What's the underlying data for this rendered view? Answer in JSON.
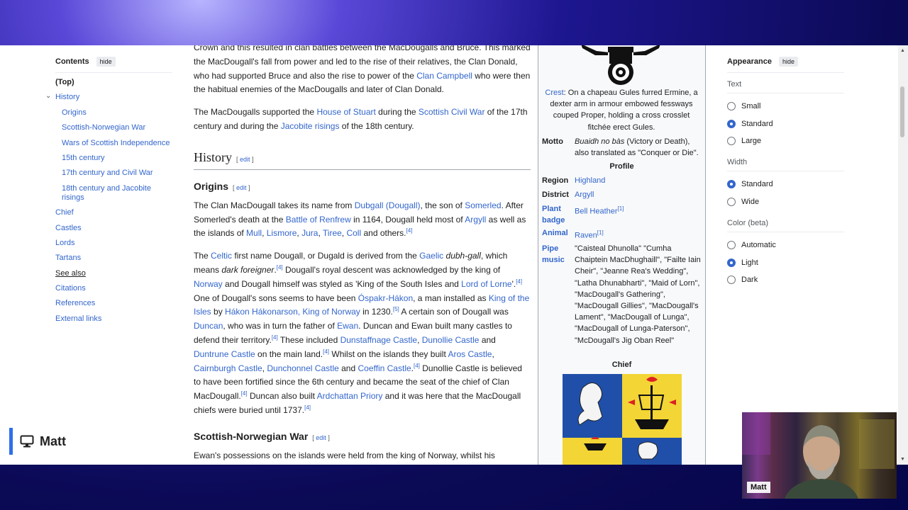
{
  "toc": {
    "title": "Contents",
    "hide_label": "hide",
    "items": [
      {
        "label": "(Top)",
        "level": 0
      },
      {
        "label": "History",
        "level": 0
      },
      {
        "label": "Origins",
        "level": 1
      },
      {
        "label": "Scottish-Norwegian War",
        "level": 1
      },
      {
        "label": "Wars of Scottish Independence",
        "level": 1
      },
      {
        "label": "15th century",
        "level": 1
      },
      {
        "label": "17th century and Civil War",
        "level": 1
      },
      {
        "label": "18th century and Jacobite risings",
        "level": 1
      },
      {
        "label": "Chief",
        "level": 0
      },
      {
        "label": "Castles",
        "level": 0
      },
      {
        "label": "Lords",
        "level": 0
      },
      {
        "label": "Tartans",
        "level": 0
      },
      {
        "label": "See also",
        "level": 0
      },
      {
        "label": "Citations",
        "level": 0
      },
      {
        "label": "References",
        "level": 0
      },
      {
        "label": "External links",
        "level": 0
      }
    ]
  },
  "article": {
    "p1_a": "Crown and this resulted in clan battles between the MacDougalls and Bruce. This marked the MacDougall's fall from power and led to the rise of their relatives, the Clan Donald, who had supported Bruce and also the rise to power of the ",
    "p1_link": "Clan Campbell",
    "p1_b": " who were then the habitual enemies of the MacDougalls and later of Clan Donald.",
    "p2_a": "The MacDougalls supported the ",
    "p2_l1": "House of Stuart",
    "p2_b": " during the ",
    "p2_l2": "Scottish Civil War",
    "p2_c": " of the 17th century and during the ",
    "p2_l3": "Jacobite risings",
    "p2_d": " of the 18th century.",
    "h_history": "History",
    "edit": "edit",
    "h_origins": "Origins",
    "o1_a": "The Clan MacDougall takes its name from ",
    "o1_l1": "Dubgall (Dougall)",
    "o1_b": ", the son of ",
    "o1_l2": "Somerled",
    "o1_c": ". After Somerled's death at the ",
    "o1_l3": "Battle of Renfrew",
    "o1_d": " in 1164, Dougall held most of ",
    "o1_l4": "Argyll",
    "o1_e": " as well as the islands of ",
    "o1_l5": "Mull",
    "o1_s1": ", ",
    "o1_l6": "Lismore",
    "o1_s2": ", ",
    "o1_l7": "Jura",
    "o1_s3": ", ",
    "o1_l8": "Tiree",
    "o1_s4": ", ",
    "o1_l9": "Coll",
    "o1_f": " and others.",
    "ref4": "[4]",
    "ref5": "[5]",
    "o2_a": "The ",
    "o2_l1": "Celtic",
    "o2_b": " first name Dougall, or Dugald is derived from the ",
    "o2_l2": "Gaelic",
    "o2_c": " ",
    "o2_i1": "dubh-gall",
    "o2_d": ", which means ",
    "o2_i2": "dark foreigner",
    "o2_e": ".",
    "o2_f": " Dougall's royal descent was acknowledged by the king of ",
    "o2_l3": "Norway",
    "o2_g": " and Dougall himself was styled as 'King of the South Isles and ",
    "o2_l4": "Lord of Lorne",
    "o2_h": "'.",
    "o2_i": " One of Dougall's sons seems to have been ",
    "o2_l5": "Óspakr-Hákon",
    "o2_j": ", a man installed as ",
    "o2_l6": "King of the Isles",
    "o2_k": " by ",
    "o2_l7": "Hákon Hákonarson, King of Norway",
    "o2_l": " in 1230.",
    "o2_m": " A certain son of Dougall was ",
    "o2_l8": "Duncan",
    "o2_n": ", who was in turn the father of ",
    "o2_l9": "Ewan",
    "o2_o": ". Duncan and Ewan built many castles to defend their territory.",
    "o2_p": " These included ",
    "o2_l10": "Dunstaffnage Castle",
    "o2_q": ", ",
    "o2_l11": "Dunollie Castle",
    "o2_r": " and ",
    "o2_l12": "Duntrune Castle",
    "o2_s": " on the main land.",
    "o2_t": " Whilst on the islands they built ",
    "o2_l13": "Aros Castle",
    "o2_u": ", ",
    "o2_l14": "Cairnburgh Castle",
    "o2_v": ", ",
    "o2_l15": "Dunchonnel Castle",
    "o2_w": " and ",
    "o2_l16": "Coeffin Castle",
    "o2_x": ".",
    "o2_y": " Dunollie Castle is believed to have been fortified since the 6th century and became the seat of the chief of Clan MacDougall.",
    "o2_z": " Duncan also built ",
    "o2_l17": "Ardchattan Priory",
    "o2_aa": " and it was here that the MacDougall chiefs were buried until 1737.",
    "h_snw": "Scottish-Norwegian War",
    "snw_a": "Ewan's possessions on the islands were held from the king of Norway, whilst his"
  },
  "infobox": {
    "crest_link": "Crest",
    "crest_text": ": On a chapeau Gules furred Ermine, a dexter arm in armour embowed fessways couped Proper, holding a cross crosslet fitchée erect Gules.",
    "motto_label": "Motto",
    "motto_italic": "Buaidh no bàs",
    "motto_rest": " (Victory or Death), also translated as \"Conquer or Die\".",
    "profile_head": "Profile",
    "region_label": "Region",
    "region_val": "Highland",
    "district_label": "District",
    "district_val": "Argyll",
    "plant_label": "Plant badge",
    "plant_val": "Bell Heather",
    "animal_label": "Animal",
    "animal_val": "Raven",
    "ref1": "[1]",
    "pipe_label": "Pipe music",
    "pipe_val": "\"Caisteal Dhunolla\" \"Cumha Chaiptein MacDhughaill\", \"Failte Iain Cheir\", \"Jeanne Rea's Wedding\", \"Latha Dhunabharti\", \"Maid of Lorn\", \"MacDougall's Gathering\", \"MacDougall Gillies\", \"MacDougall's Lament\", \"MacDougall of Lunga\", \"MacDougall of Lunga-Paterson\", \"McDougall's Jig Oban Reel\"",
    "chief_head": "Chief"
  },
  "appearance": {
    "title": "Appearance",
    "hide_label": "hide",
    "text_group": "Text",
    "text_options": [
      "Small",
      "Standard",
      "Large"
    ],
    "width_group": "Width",
    "width_options": [
      "Standard",
      "Wide"
    ],
    "color_group": "Color (beta)",
    "color_options": [
      "Automatic",
      "Light",
      "Dark"
    ]
  },
  "overlay": {
    "presenter_name": "Matt",
    "webcam_label": "Matt"
  },
  "colors": {
    "link": "#3366cc",
    "accent_blue": "#2f6fe9",
    "infobox_bg": "#f8f9fa"
  }
}
